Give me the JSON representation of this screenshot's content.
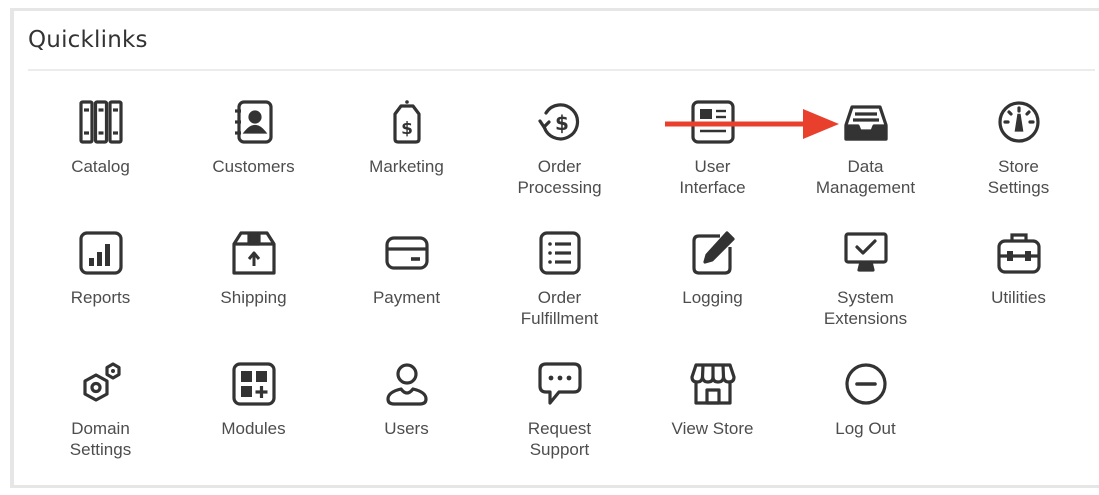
{
  "panel": {
    "title": "Quicklinks"
  },
  "tiles": [
    {
      "id": "catalog",
      "icon": "catalog-icon",
      "lines": [
        "Catalog"
      ]
    },
    {
      "id": "customers",
      "icon": "customers-icon",
      "lines": [
        "Customers"
      ]
    },
    {
      "id": "marketing",
      "icon": "marketing-icon",
      "lines": [
        "Marketing"
      ]
    },
    {
      "id": "order-processing",
      "icon": "order-processing-icon",
      "lines": [
        "Order",
        "Processing"
      ]
    },
    {
      "id": "user-interface",
      "icon": "user-interface-icon",
      "lines": [
        "User",
        "Interface"
      ]
    },
    {
      "id": "data-management",
      "icon": "data-management-icon",
      "lines": [
        "Data",
        "Management"
      ]
    },
    {
      "id": "store-settings",
      "icon": "store-settings-icon",
      "lines": [
        "Store",
        "Settings"
      ]
    },
    {
      "id": "reports",
      "icon": "reports-icon",
      "lines": [
        "Reports"
      ]
    },
    {
      "id": "shipping",
      "icon": "shipping-icon",
      "lines": [
        "Shipping"
      ]
    },
    {
      "id": "payment",
      "icon": "payment-icon",
      "lines": [
        "Payment"
      ]
    },
    {
      "id": "order-fulfillment",
      "icon": "order-fulfillment-icon",
      "lines": [
        "Order",
        "Fulfillment"
      ]
    },
    {
      "id": "logging",
      "icon": "logging-icon",
      "lines": [
        "Logging"
      ]
    },
    {
      "id": "system-extensions",
      "icon": "system-extensions-icon",
      "lines": [
        "System",
        "Extensions"
      ]
    },
    {
      "id": "utilities",
      "icon": "utilities-icon",
      "lines": [
        "Utilities"
      ]
    },
    {
      "id": "domain-settings",
      "icon": "domain-settings-icon",
      "lines": [
        "Domain",
        "Settings"
      ]
    },
    {
      "id": "modules",
      "icon": "modules-icon",
      "lines": [
        "Modules"
      ]
    },
    {
      "id": "users",
      "icon": "users-icon",
      "lines": [
        "Users"
      ]
    },
    {
      "id": "request-support",
      "icon": "request-support-icon",
      "lines": [
        "Request",
        "Support"
      ]
    },
    {
      "id": "view-store",
      "icon": "view-store-icon",
      "lines": [
        "View Store"
      ]
    },
    {
      "id": "log-out",
      "icon": "log-out-icon",
      "lines": [
        "Log Out"
      ]
    }
  ],
  "colors": {
    "icon": "#333333",
    "label": "#4d4d4d",
    "arrow": "#e8402c",
    "rule": "#ececec"
  }
}
